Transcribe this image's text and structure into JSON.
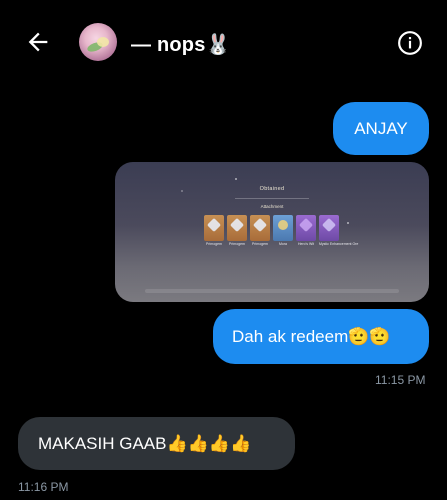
{
  "header": {
    "contact_name": "— nops🐰",
    "back_icon": "back-arrow-icon",
    "info_icon": "info-circle-icon"
  },
  "messages": [
    {
      "direction": "outgoing",
      "text": "ANJAY"
    },
    {
      "direction": "outgoing",
      "type": "image",
      "image": {
        "title": "Obtained",
        "subtitle": "Attachment",
        "items": [
          "Primogem",
          "Primogem",
          "Primogem",
          "Mora",
          "Hero's Wit",
          "Mystic Enhancement Ore"
        ]
      }
    },
    {
      "direction": "outgoing",
      "text": "Dah ak redeem🫡🫡",
      "time": "11:15 PM"
    },
    {
      "direction": "incoming",
      "text": "MAKASIH GAAB👍👍👍👍",
      "time": "11:16 PM"
    }
  ],
  "colors": {
    "outgoing_bubble": "#1d8cf0",
    "incoming_bubble": "#2e3338",
    "timestamp": "#8b98a5",
    "background": "#000000"
  }
}
